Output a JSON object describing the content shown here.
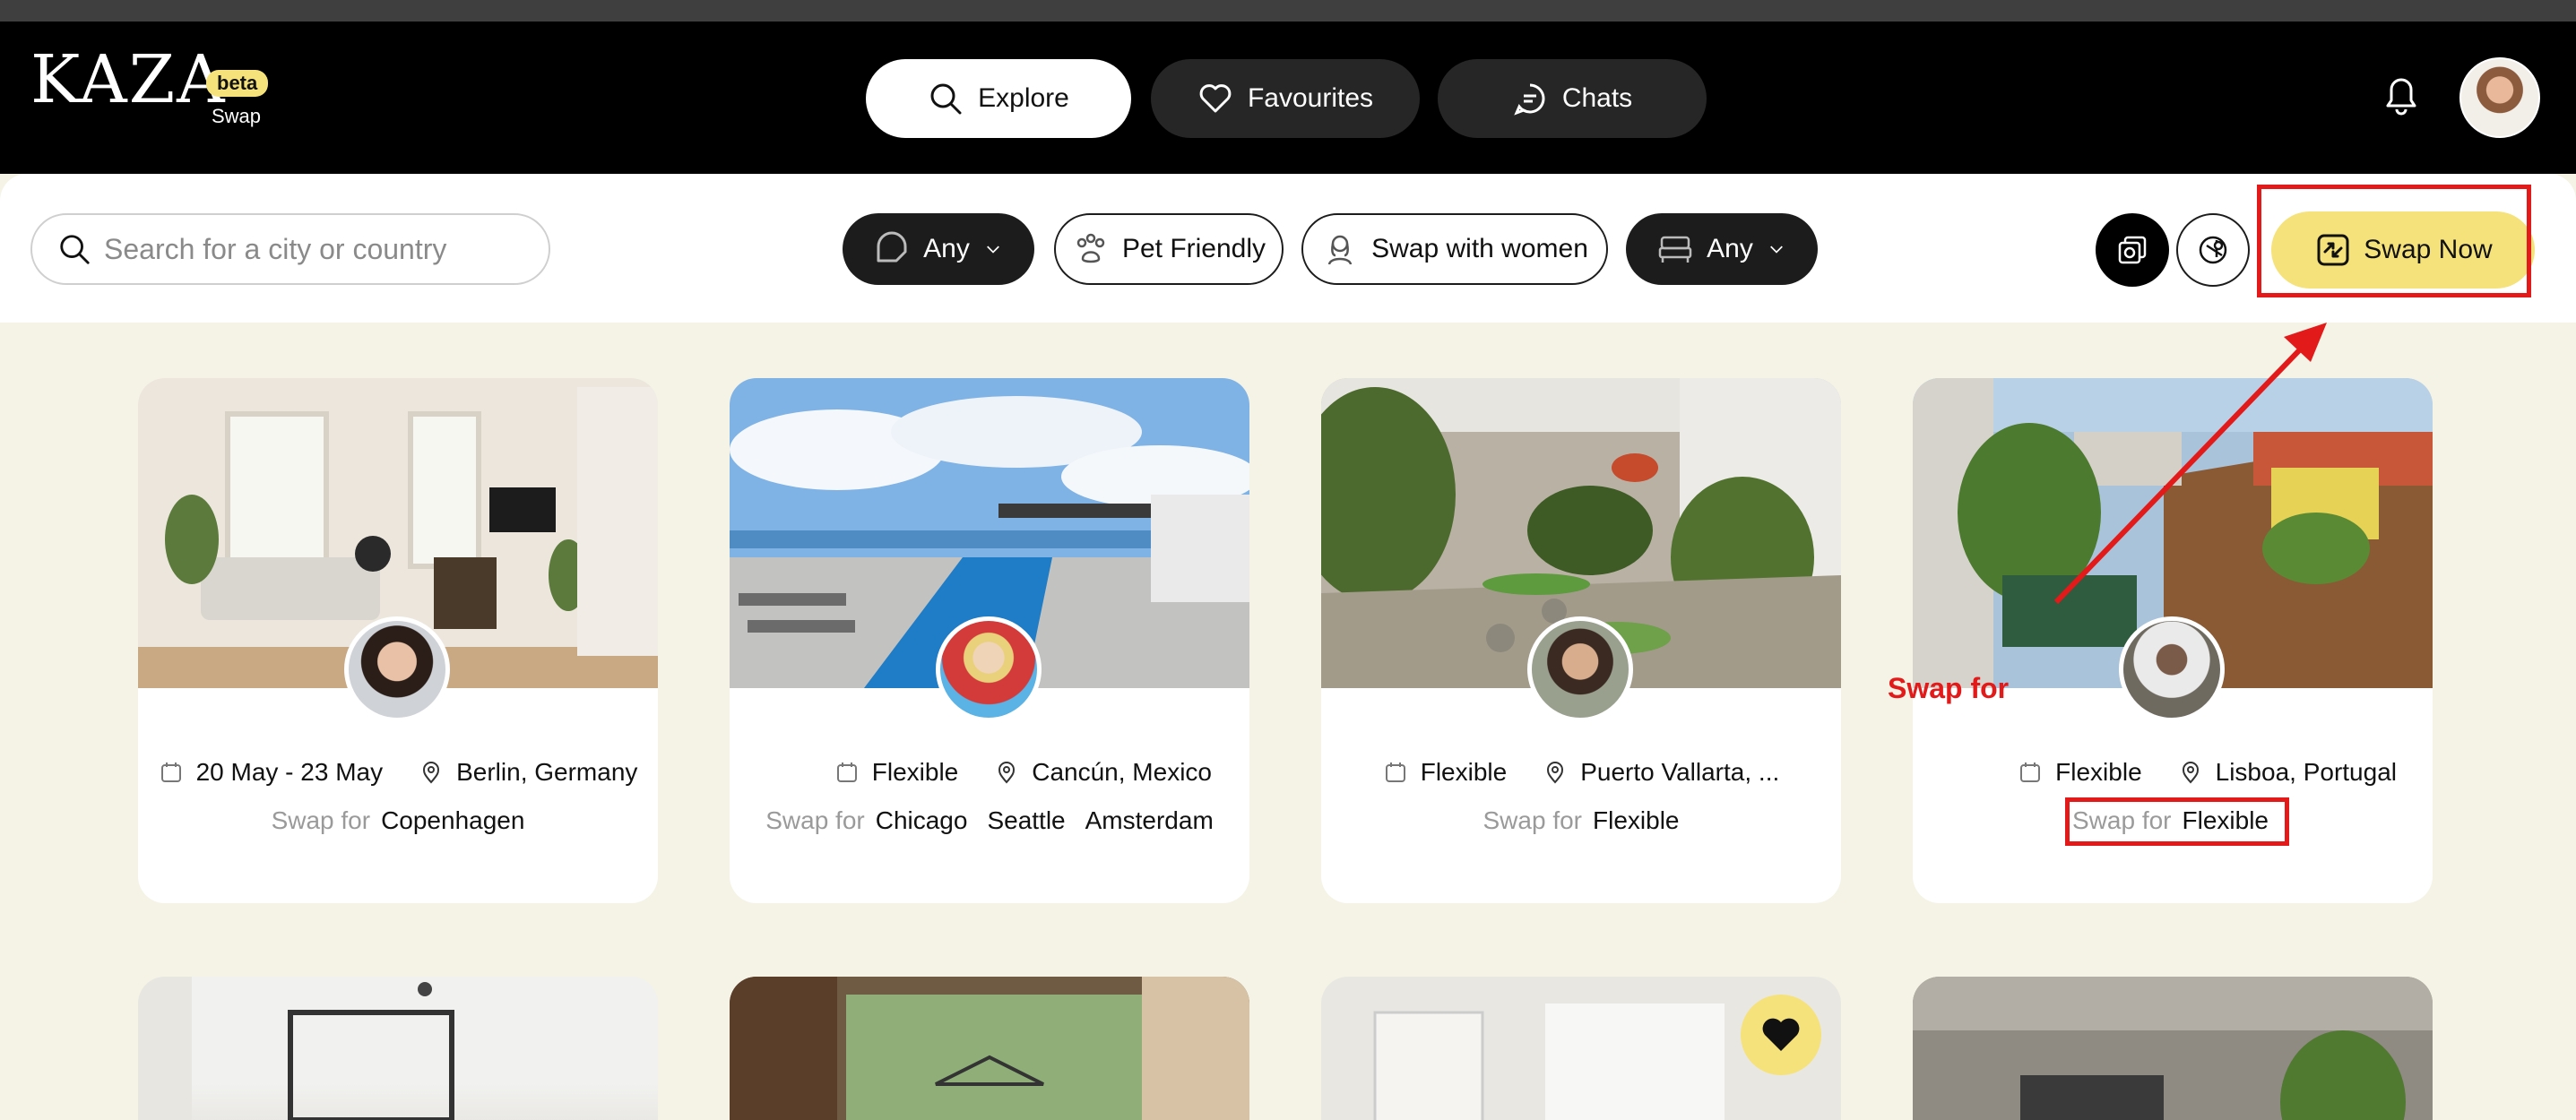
{
  "header": {
    "logo": "KAZA",
    "beta_badge": "beta",
    "logo_sub": "Swap",
    "nav": [
      {
        "label": "Explore",
        "icon": "search-icon",
        "active": true
      },
      {
        "label": "Favourites",
        "icon": "heart-icon",
        "active": false
      },
      {
        "label": "Chats",
        "icon": "chat-icon",
        "active": false
      }
    ]
  },
  "filters": {
    "search_placeholder": "Search for a city or country",
    "home_type": "Any",
    "pet_friendly": "Pet Friendly",
    "swap_with_women": "Swap with women",
    "bedrooms": "Any",
    "swap_now": "Swap Now"
  },
  "listings": [
    {
      "dates": "20 May - 23 May",
      "location": "Berlin, Germany",
      "swap_for_label": "Swap for",
      "swap_for": [
        "Copenhagen"
      ]
    },
    {
      "dates": "Flexible",
      "location": "Cancún, Mexico",
      "swap_for_label": "Swap for",
      "swap_for": [
        "Chicago",
        "Seattle",
        "Amsterdam"
      ]
    },
    {
      "dates": "Flexible",
      "location": "Puerto Vallarta, ...",
      "swap_for_label": "Swap for",
      "swap_for": [
        "Flexible"
      ]
    },
    {
      "dates": "Flexible",
      "location": "Lisboa, Portugal",
      "swap_for_label": "Swap for",
      "swap_for": [
        "Flexible"
      ]
    }
  ],
  "annotations": {
    "swap_for_note": "Swap for"
  },
  "colors": {
    "accent_yellow": "#f6e27a",
    "header_bg": "#000000",
    "content_bg": "#f4f3e6",
    "annotation_red": "#e21a1a"
  }
}
